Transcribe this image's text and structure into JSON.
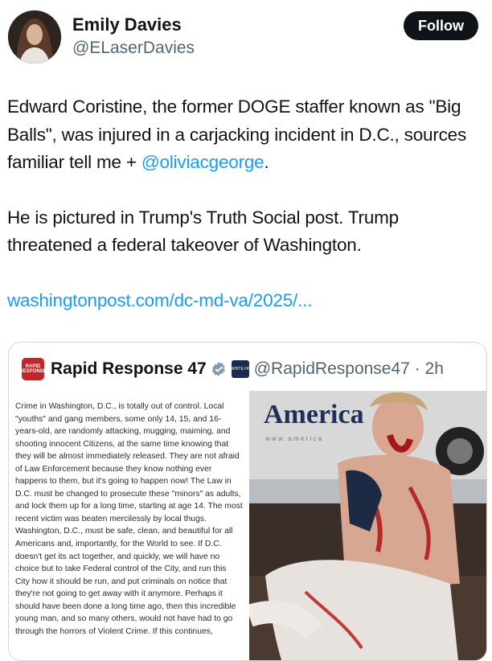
{
  "author": {
    "name": "Emily Davies",
    "handle": "@ELaserDavies",
    "follow_label": "Follow"
  },
  "tweet": {
    "p1_before": "Edward Coristine, the former DOGE staffer known as \"Big Balls\", was injured in a carjacking incident in D.C., sources familiar tell me + ",
    "p1_mention": "@oliviacgeorge",
    "p1_after": ".",
    "p2": "He is pictured in Trump's Truth Social post. Trump threatened a federal takeover of Washington.",
    "link": "washingtonpost.com/dc-md-va/2025/..."
  },
  "quoted": {
    "name": "Rapid Response 47",
    "handle": "@RapidResponse47",
    "sep": " · ",
    "time": "2h",
    "logo_text": [
      "RAPID",
      "RESPONSE"
    ],
    "wh_logo_text": "THE WHITE HOUSE",
    "image_text": "Crime in Washington, D.C., is totally out of control. Local \"youths\" and gang members, some only 14, 15, and 16-years-old, are randomly attacking, mugging, maiming, and shooting innocent Citizens, at the same time knowing that they will be almost immediately released. They are not afraid of Law Enforcement because they know nothing ever happens to them, but it's going to happen now! The Law in D.C. must be changed to prosecute these \"minors\" as adults, and lock them up for a long time, starting at age 14. The most recent victim was beaten mercilessly by local thugs. Washington, D.C., must be safe, clean, and beautiful for all Americans and, importantly, for the World to see. If D.C. doesn't get its act together, and quickly, we will have no choice but to take Federal control of the City, and run this City how it should be run, and put criminals on notice that they're not going to get away with it anymore. Perhaps it should have been done a long time ago, then this incredible young man, and so many others, would not have had to go through the horrors of Violent Crime. If this continues,",
    "photo_sign": "America",
    "photo_sign_small": "w w w . a m e r i c a"
  },
  "colors": {
    "link": "#1d9bf0",
    "secondary": "#536471",
    "verified": "#829aab",
    "brand_red": "#c3232b"
  }
}
